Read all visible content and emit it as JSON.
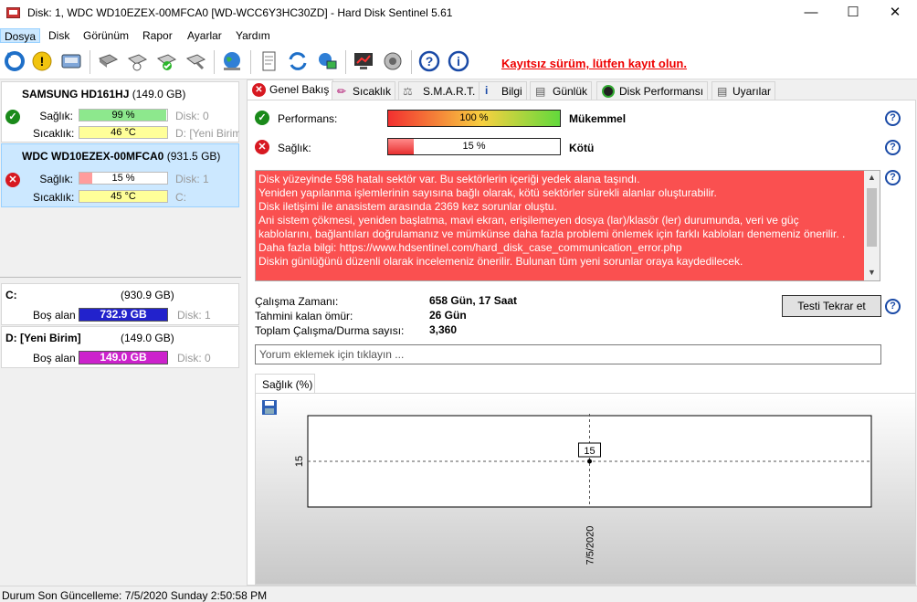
{
  "window": {
    "title": "Disk: 1, WDC WD10EZEX-00MFCA0 [WD-WCC6Y3HC30ZD]  -  Hard Disk Sentinel 5.61"
  },
  "menu": [
    "Dosya",
    "Disk",
    "Görünüm",
    "Rapor",
    "Ayarlar",
    "Yardım"
  ],
  "toolbar": {
    "register_text": "Kayıtsız sürüm, lütfen kayıt olun."
  },
  "disks": [
    {
      "name": "SAMSUNG HD161HJ",
      "size": "(149.0 GB)",
      "status": "ok",
      "health_label": "Sağlık:",
      "health": "99 %",
      "health_pct": 99,
      "health_color": "#8de88d",
      "disk_no": "Disk: 0",
      "temp_label": "Sıcaklık:",
      "temp": "46 °C",
      "temp_color": "#ffff99",
      "drive": "D: [Yeni Birim]"
    },
    {
      "name": "WDC WD10EZEX-00MFCA0",
      "size": "(931.5 GB)",
      "status": "bad",
      "health_label": "Sağlık:",
      "health": "15 %",
      "health_pct": 15,
      "health_color": "#ff9c9c",
      "disk_no": "Disk: 1",
      "temp_label": "Sıcaklık:",
      "temp": "45 °C",
      "temp_color": "#ffff99",
      "drive": "C:"
    }
  ],
  "partitions": [
    {
      "name": "C:",
      "size": "(930.9 GB)",
      "free_label": "Boş alan",
      "free": "732.9 GB",
      "free_color": "#2222cc",
      "disk": "Disk: 1"
    },
    {
      "name": "D: [Yeni Birim]",
      "size": "(149.0 GB)",
      "free_label": "Boş alan",
      "free": "149.0 GB",
      "free_color": "#cc22cc",
      "disk": "Disk: 0"
    }
  ],
  "tabs": [
    "Genel Bakış",
    "Sıcaklık",
    "S.M.A.R.T.",
    "Bilgi",
    "Günlük",
    "Disk Performansı",
    "Uyarılar"
  ],
  "overview": {
    "performance_label": "Performans:",
    "performance_value": "100 %",
    "performance_pct": 100,
    "performance_text": "Mükemmel",
    "health_label": "Sağlık:",
    "health_value": "15 %",
    "health_pct": 15,
    "health_text": "Kötü",
    "message_lines": [
      "Disk yüzeyinde 598 hatalı sektör var. Bu sektörlerin içeriği yedek alana taşındı.",
      "Yeniden yapılanma işlemlerinin sayısına bağlı olarak, kötü sektörler sürekli alanlar oluşturabilir.",
      "Disk iletişimi ile anasistem arasında 2369 kez sorunlar oluştu.",
      "Ani sistem çökmesi, yeniden başlatma, mavi ekran, erişilemeyen dosya (lar)/klasör (ler) durumunda, veri ve güç",
      "kablolarını, bağlantıları doğrulamanız ve mümkünse daha fazla problemi önlemek için farklı kabloları denemeniz önerilir. .",
      "Daha fazla bilgi: https://www.hdsentinel.com/hard_disk_case_communication_error.php",
      "Diskin günlüğünü düzenli olarak incelemeniz önerilir. Bulunan tüm yeni sorunlar oraya kaydedilecek."
    ],
    "uptime_label": "Çalışma Zamanı:",
    "uptime": "658 Gün, 17 Saat",
    "remaining_label": "Tahmini kalan ömür:",
    "remaining": "26 Gün",
    "starts_label": "Toplam Çalışma/Durma sayısı:",
    "starts": "3,360",
    "retest_button": "Testi Tekrar et",
    "comment_placeholder": "Yorum eklemek için tıklayın ..."
  },
  "chart_tab": "Sağlık (%)",
  "chart_data": {
    "type": "line",
    "x": [
      "7/5/2020"
    ],
    "series": [
      {
        "values": [
          15
        ]
      }
    ],
    "ytick": "15",
    "xtick": "7/5/2020",
    "data_label": "15"
  },
  "status": {
    "text": "Durum Son Güncelleme: 7/5/2020 Sunday 2:50:58 PM"
  }
}
